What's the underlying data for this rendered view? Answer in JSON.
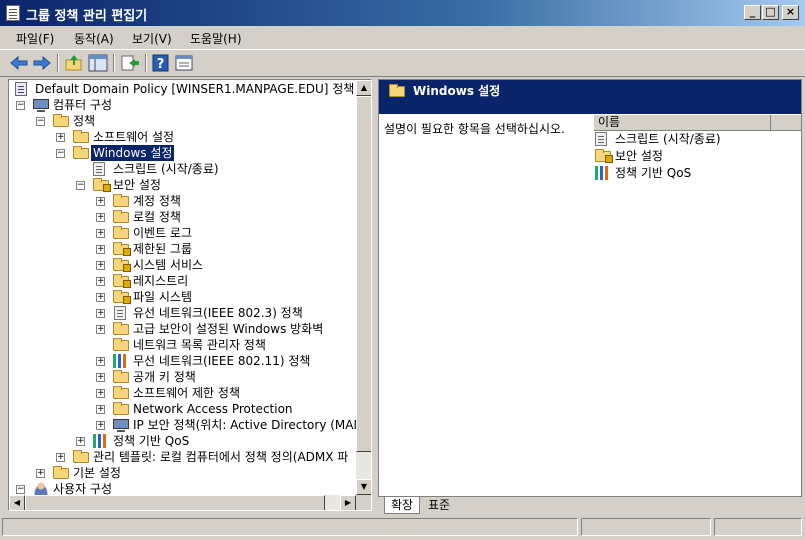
{
  "window": {
    "title": "그룹 정책 관리 편집기",
    "controls": {
      "minimize": "_",
      "maximize": "□",
      "close": "×"
    }
  },
  "menu": [
    {
      "label": "파일(F)"
    },
    {
      "label": "동작(A)"
    },
    {
      "label": "보기(V)"
    },
    {
      "label": "도움말(H)"
    }
  ],
  "toolbar": {
    "buttons": [
      "back-icon",
      "forward-icon",
      "up-folder-icon",
      "show-hide-tree-icon",
      "export-list-icon",
      "help-icon",
      "properties-icon"
    ],
    "help_glyph": "?"
  },
  "tree": {
    "root": "Default Domain Policy [WINSER1.MANPAGE.EDU] 정책",
    "computer_config": "컴퓨터 구성",
    "policies": "정책",
    "software_settings": "소프트웨어 설정",
    "windows_settings": "Windows 설정",
    "scripts": "스크립트 (시작/종료)",
    "security_settings": "보안 설정",
    "security_children": [
      "계정 정책",
      "로컬 정책",
      "이벤트 로그",
      "제한된 그룹",
      "시스템 서비스",
      "레지스트리",
      "파일 시스템",
      "유선 네트워크(IEEE 802.3) 정책",
      "고급 보안이 설정된 Windows 방화벽",
      "네트워크 목록 관리자 정책",
      "무선 네트워크(IEEE 802.11) 정책",
      "공개 키 정책",
      "소프트웨어 제한 정책",
      "Network Access Protection",
      "IP 보안 정책(위치: Active Directory (MAN"
    ],
    "qos": "정책 기반 QoS",
    "admin_templates": "관리 템플릿: 로컬 컴퓨터에서 정책 정의(ADMX 파",
    "preferences": "기본 설정",
    "user_config": "사용자 구성"
  },
  "right_pane": {
    "header": "Windows 설정",
    "description": "설명이 필요한 항목을 선택하십시오.",
    "column_name": "이름",
    "items": [
      "스크립트 (시작/종료)",
      "보안 설정",
      "정책 기반 QoS"
    ]
  },
  "tabs": {
    "extended": "확장",
    "standard": "표준"
  }
}
